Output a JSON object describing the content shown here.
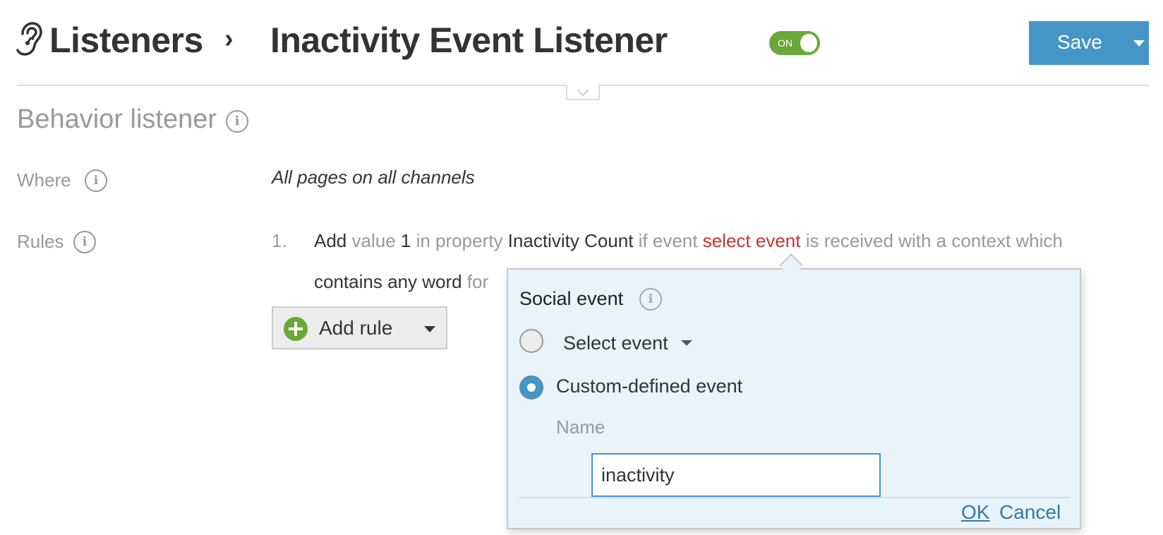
{
  "header": {
    "breadcrumb_root": "Listeners",
    "breadcrumb_separator": "›",
    "title": "Inactivity Event Listener",
    "toggle": {
      "label": "ON",
      "state": "on"
    },
    "save_label": "Save"
  },
  "section": {
    "title": "Behavior listener",
    "info_glyph": "i"
  },
  "where": {
    "label": "Where",
    "info_glyph": "i",
    "value": "All pages on all channels"
  },
  "rules": {
    "label": "Rules",
    "info_glyph": "i",
    "items": [
      {
        "number": "1.",
        "action": "Add",
        "value_word": "value",
        "value": "1",
        "property_word": "in property",
        "property": "Inactivity Count",
        "event_word": "if event",
        "event": "select event",
        "context_text": "is received with a context which",
        "condition": "contains any word",
        "for_word": "for"
      }
    ],
    "add_rule_label": "Add rule"
  },
  "popover": {
    "title": "Social event",
    "info_glyph": "i",
    "options": [
      {
        "label": "Select event",
        "selected": false
      },
      {
        "label": "Custom-defined event",
        "selected": true
      }
    ],
    "name_label": "Name",
    "name_value": "inactivity",
    "ok_label": "OK",
    "cancel_label": "Cancel"
  },
  "colors": {
    "accent_blue": "#4596c6",
    "toggle_green": "#6aa83a",
    "link_red": "#c83232",
    "popover_bg": "#e8f3fa"
  }
}
